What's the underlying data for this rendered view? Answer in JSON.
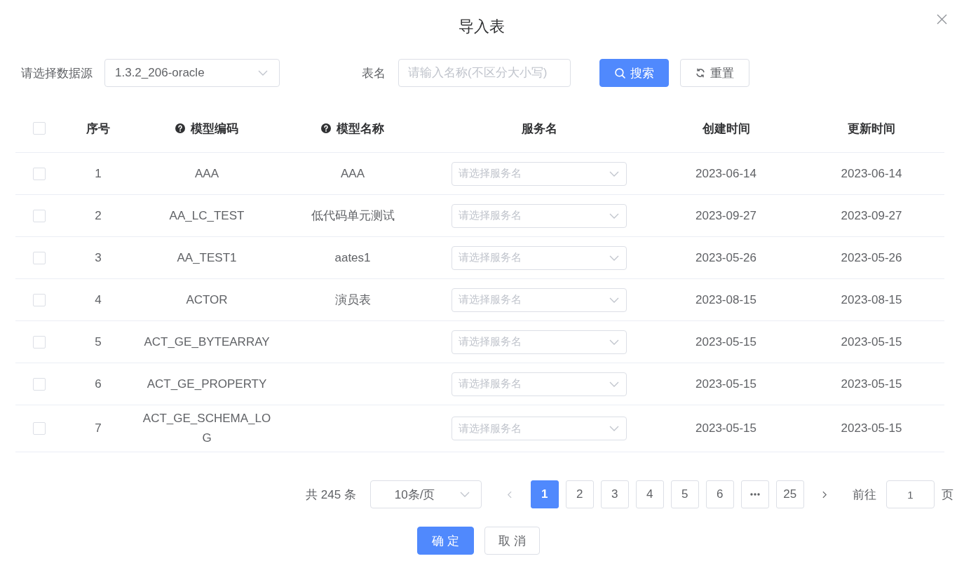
{
  "dialog": {
    "title": "导入表"
  },
  "filters": {
    "datasource": {
      "label": "请选择数据源",
      "value": "1.3.2_206-oracle"
    },
    "table_name": {
      "label": "表名",
      "placeholder": "请输入名称(不区分大小写)"
    },
    "search_button": {
      "label": "搜索"
    },
    "reset_button": {
      "label": "重置"
    }
  },
  "table": {
    "header_checkbox": {
      "checked": false
    },
    "columns": [
      {
        "kind": "plain",
        "label": "序号"
      },
      {
        "kind": "help",
        "label": "模型编码"
      },
      {
        "kind": "help",
        "label": "模型名称"
      },
      {
        "kind": "plain",
        "label": "服务名"
      },
      {
        "kind": "plain",
        "label": "创建时间"
      },
      {
        "kind": "plain",
        "label": "更新时间"
      }
    ],
    "rows": [
      {
        "checked": false,
        "index": "1",
        "model_code": "AAA",
        "model_name": "AAA",
        "service": {
          "placeholder": "请选择服务名"
        },
        "created": "2023-06-14",
        "updated": "2023-06-14"
      },
      {
        "checked": false,
        "index": "2",
        "model_code": "AA_LC_TEST",
        "model_name": "低代码单元测试",
        "service": {
          "placeholder": "请选择服务名"
        },
        "created": "2023-09-27",
        "updated": "2023-09-27"
      },
      {
        "checked": false,
        "index": "3",
        "model_code": "AA_TEST1",
        "model_name": "aates1",
        "service": {
          "placeholder": "请选择服务名"
        },
        "created": "2023-05-26",
        "updated": "2023-05-26"
      },
      {
        "checked": false,
        "index": "4",
        "model_code": "ACTOR",
        "model_name": "演员表",
        "service": {
          "placeholder": "请选择服务名"
        },
        "created": "2023-08-15",
        "updated": "2023-08-15"
      },
      {
        "checked": false,
        "index": "5",
        "model_code": "ACT_GE_BYTEARRAY",
        "service": {
          "placeholder": "请选择服务名"
        },
        "created": "2023-05-15",
        "updated": "2023-05-15"
      },
      {
        "checked": false,
        "index": "6",
        "model_code": "ACT_GE_PROPERTY",
        "service": {
          "placeholder": "请选择服务名"
        },
        "created": "2023-05-15",
        "updated": "2023-05-15"
      },
      {
        "checked": false,
        "index": "7",
        "model_code": "ACT_GE_SCHEMA_LOG",
        "service": {
          "placeholder": "请选择服务名"
        },
        "created": "2023-05-15",
        "updated": "2023-05-15"
      }
    ]
  },
  "pagination": {
    "total": "共 245 条",
    "page_size": "10条/页",
    "prev": {
      "disabled": true
    },
    "pages": [
      {
        "kind": "page",
        "label": "1",
        "selected": true
      },
      {
        "kind": "page",
        "label": "2",
        "selected": false
      },
      {
        "kind": "page",
        "label": "3",
        "selected": false
      },
      {
        "kind": "page",
        "label": "4",
        "selected": false
      },
      {
        "kind": "page",
        "label": "5",
        "selected": false
      },
      {
        "kind": "page",
        "label": "6",
        "selected": false
      },
      {
        "kind": "more",
        "selected": false
      },
      {
        "kind": "page",
        "label": "25",
        "selected": false
      }
    ],
    "next": {
      "disabled": false
    },
    "jump_label": "前往",
    "jump_value": "1",
    "jump_unit": "页"
  },
  "footer": {
    "confirm_button": {
      "label": "确定"
    },
    "cancel_button": {
      "label": "取消"
    }
  }
}
